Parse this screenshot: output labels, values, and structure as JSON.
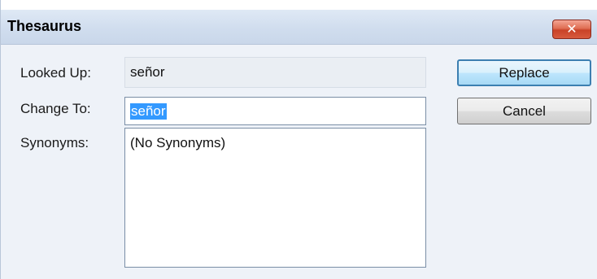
{
  "window": {
    "title": "Thesaurus",
    "close_glyph": "✕"
  },
  "form": {
    "looked_up_label": "Looked Up:",
    "looked_up_value": "señor",
    "change_to_label": "Change To:",
    "change_to_value": "señor",
    "synonyms_label": "Synonyms:",
    "synonyms_items": [
      "(No Synonyms)"
    ]
  },
  "buttons": {
    "replace_label": "Replace",
    "cancel_label": "Cancel"
  },
  "colors": {
    "selection": "#3399ff",
    "titlebar": "#d0ddee",
    "close_button": "#c94228"
  }
}
